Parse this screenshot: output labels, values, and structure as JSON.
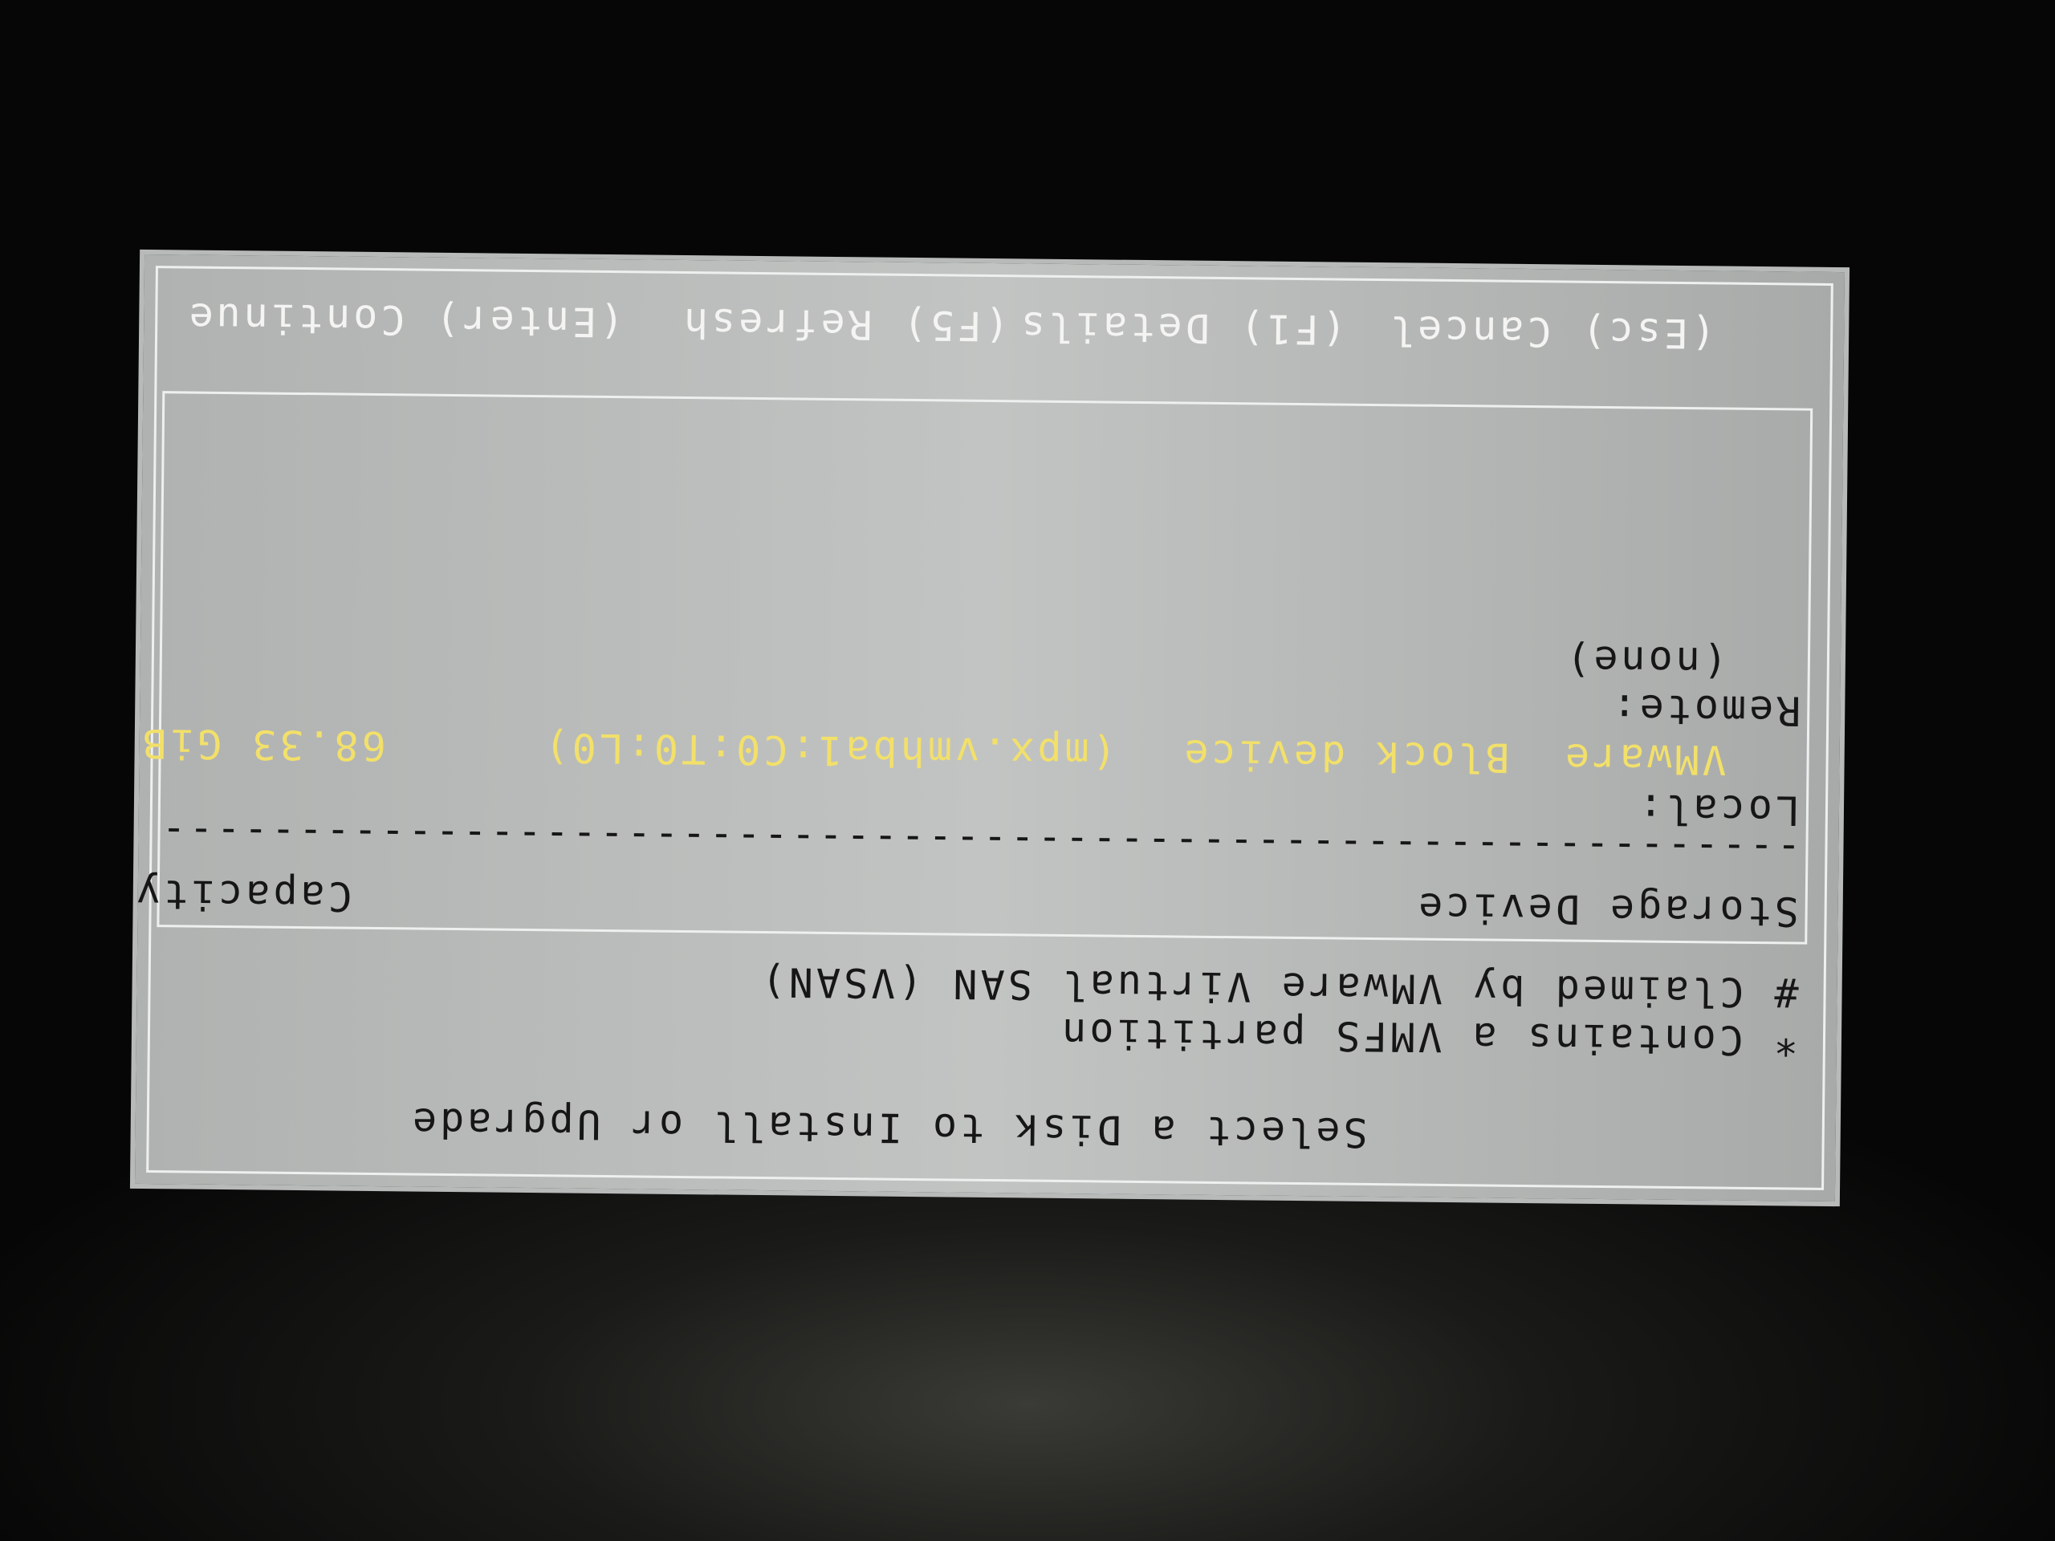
{
  "dialog": {
    "title": "Select a Disk to Install or Upgrade",
    "legend": [
      "* Contains a VMFS partition",
      "# Claimed by VMware Virtual SAN (VSAN)"
    ]
  },
  "table": {
    "headers": {
      "device": "Storage Device",
      "capacity": "Capacity"
    },
    "divider": "----------------------------------------------------------------------------------------------------------",
    "local_label": "Local:",
    "local_devices": [
      {
        "vendor": "VMware",
        "model": "Block device",
        "path": "(mpx.vmhba1:C0:T0:L0)",
        "capacity": "68.33 GiB"
      }
    ],
    "remote_label": "Remote:",
    "remote_none": "(none)"
  },
  "keys": {
    "cancel": "(Esc) Cancel",
    "details": "(F1) Details",
    "refresh": "(F5) Refresh",
    "continue": "(Enter) Continue"
  },
  "colors": {
    "dialog_bg": "#c2c4c3",
    "selected_text": "#f2e06a",
    "key_text": "#f4f4f2"
  }
}
